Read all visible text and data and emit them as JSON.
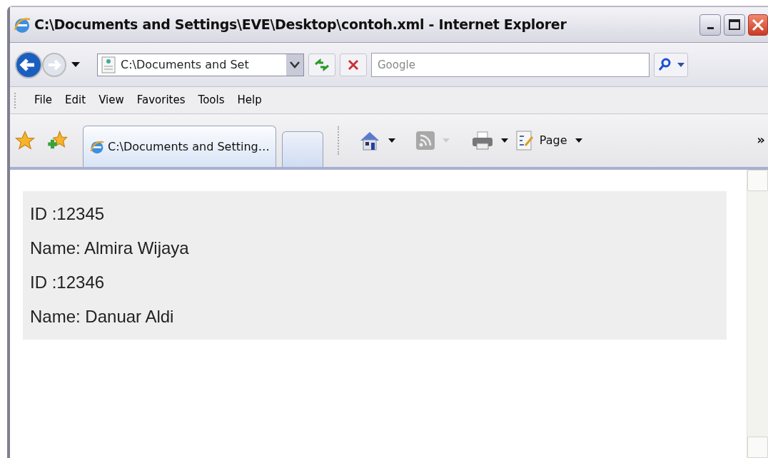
{
  "window": {
    "title": "C:\\Documents and Settings\\EVE\\Desktop\\contoh.xml - Internet Explorer"
  },
  "address_bar": {
    "value": "C:\\Documents and Set"
  },
  "search": {
    "placeholder": "Google"
  },
  "menu": [
    "File",
    "Edit",
    "View",
    "Favorites",
    "Tools",
    "Help"
  ],
  "tabs": [
    {
      "label": "C:\\Documents and Setting…",
      "selected": true
    },
    {
      "selected": false
    }
  ],
  "command_bar": {
    "page_label": "Page",
    "overflow": "»"
  },
  "content": {
    "lines": [
      "ID :12345",
      "Name: Almira Wijaya",
      "ID :12346",
      "Name: Danuar Aldi"
    ]
  }
}
